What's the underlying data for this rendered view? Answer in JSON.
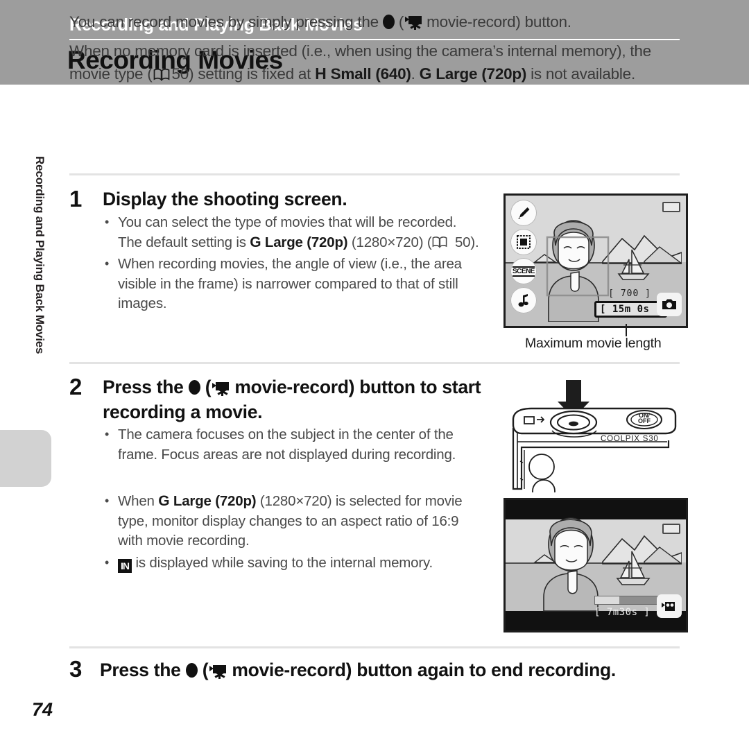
{
  "header": {
    "section": "Recording and Playing Back Movies",
    "title": "Recording Movies"
  },
  "side_tab": {
    "label": "Recording and Playing Back Movies"
  },
  "intro": {
    "line1_pre": "You can record movies by simply pressing the ",
    "line1_mid": " (",
    "line1_post": " movie-record) button.",
    "line2_a": "When no memory card is inserted (i.e., when using the camera’s internal memory), the movie type (",
    "line2_ref": "50",
    "line2_b": ") setting is fixed at ",
    "line2_h": "H",
    "line2_small": "Small (640)",
    "line2_c": ". ",
    "line2_g": "G",
    "line2_large": "Large (720p)",
    "line2_d": " is not available."
  },
  "steps": [
    {
      "number": "1",
      "heading": "Display the shooting screen.",
      "bullets": [
        {
          "a": "You can select the type of movies that will be recorded. The default setting is ",
          "icon_g": "G",
          "bold": "Large (720p)",
          "b": " (1280×720) (",
          "ref": "50",
          "c": ")."
        },
        {
          "a": "When recording movies, the angle of view (i.e., the area visible in the frame) is narrower compared to that of still images."
        }
      ]
    },
    {
      "number": "2",
      "heading_pre": "Press the ",
      "heading_mid": " (",
      "heading_post": " movie-record) button to start recording a movie.",
      "bullets": [
        {
          "a": "The camera focuses on the subject in the center of the frame. Focus areas are not displayed during recording."
        },
        {
          "a": "When ",
          "icon_g": "G",
          "bold": "Large (720p)",
          "b": " (1280×720) is selected for movie type, monitor display changes to an aspect ratio of 16:9 with movie recording."
        },
        {
          "icon_in": "IN",
          "a2": " is displayed while saving to the internal memory."
        }
      ]
    },
    {
      "number": "3",
      "heading_pre": "Press the ",
      "heading_mid": " (",
      "heading_post": " movie-record) button again to end recording."
    }
  ],
  "monitor_shooting": {
    "icons": [
      "decorate-icon",
      "frame-icon",
      "scene-icon",
      "music-note-icon"
    ],
    "scene_label": "SCENE",
    "shots_remaining": "[   700 ]",
    "movie_time": "[ 15m 0s ]",
    "caption": "Maximum movie length"
  },
  "camera_body": {
    "model_label": "COOLPIX S30",
    "power_label_on": "ON/",
    "power_label_off": "OFF"
  },
  "monitor_recording": {
    "elapsed_time": "[   7m30s ]",
    "progress_percent": 38
  },
  "page_number": "74",
  "colors": {
    "header_band": "#9d9d9d",
    "header_section_text": "#ffffff",
    "title_text": "#111111",
    "body_text": "#3a3a3a",
    "rule": "#e3e3e3",
    "tab_marker": "#d2d2d2"
  }
}
